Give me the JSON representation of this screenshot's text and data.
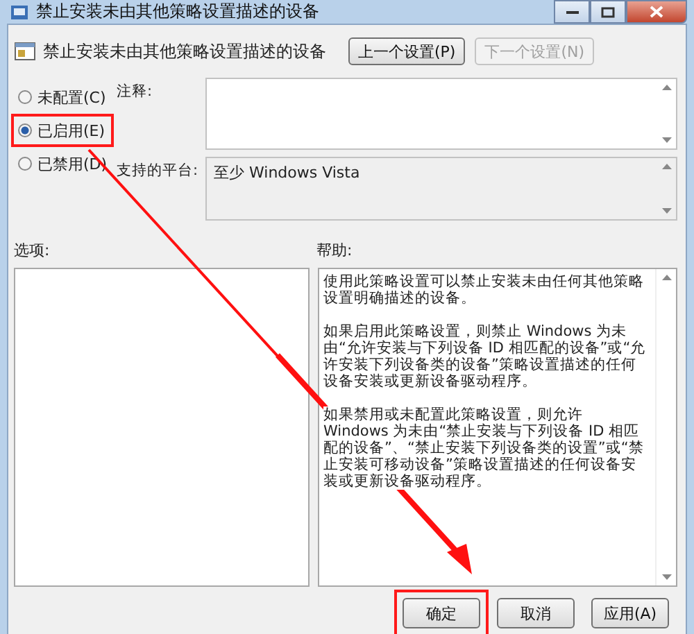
{
  "window": {
    "title": "禁止安装未由其他策略设置描述的设备"
  },
  "header": {
    "title": "禁止安装未由其他策略设置描述的设备",
    "buttons": [
      {
        "label": "上一个设置(P)",
        "disabled": false
      },
      {
        "label": "下一个设置(N)",
        "disabled": true
      }
    ]
  },
  "state_options": [
    {
      "label": "未配置(C)",
      "selected": false,
      "highlighted": false
    },
    {
      "label": "已启用(E)",
      "selected": true,
      "highlighted": true
    },
    {
      "label": "已禁用(D)",
      "selected": false,
      "highlighted": false
    }
  ],
  "comment": {
    "label": "注释:"
  },
  "platform": {
    "label": "支持的平台:",
    "value": "至少 Windows Vista"
  },
  "options": {
    "label": "选项:"
  },
  "help": {
    "label": "帮助:",
    "paragraphs": [
      "使用此策略设置可以禁止安装未由任何其他策略设置明确描述的设备。",
      "如果启用此策略设置，则禁止 Windows 为未由“允许安装与下列设备 ID 相匹配的设备”或“允许安装下列设备类的设备”策略设置描述的任何设备安装或更新设备驱动程序。",
      "如果禁用或未配置此策略设置，则允许 Windows 为未由“禁止安装与下列设备 ID 相匹配的设备”、“禁止安装下列设备类的设置”或“禁止安装可移动设备”策略设置描述的任何设备安装或更新设备驱动程序。"
    ]
  },
  "buttons": [
    {
      "label": "确定",
      "disabled": false,
      "highlighted": true
    },
    {
      "label": "取消",
      "disabled": false,
      "highlighted": false
    },
    {
      "label": "应用(A)",
      "disabled": false,
      "highlighted": false
    }
  ]
}
